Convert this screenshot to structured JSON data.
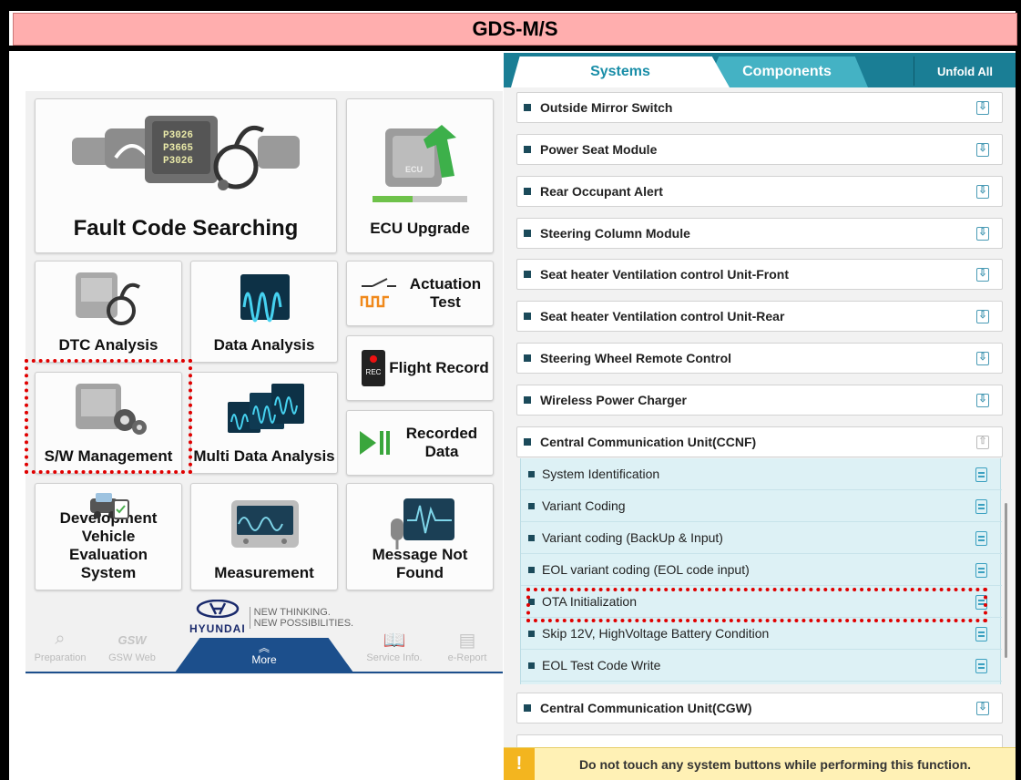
{
  "header": {
    "title": "GDS-M/S"
  },
  "left": {
    "tiles": {
      "fault_code": "Fault Code Searching",
      "ecu_upgrade": "ECU Upgrade",
      "dtc": "DTC Analysis",
      "data_analysis": "Data Analysis",
      "actuation": "Actuation Test",
      "flight_record": "Flight Record",
      "sw_management": "S/W Management",
      "multi_data": "Multi Data Analysis",
      "recorded_data": "Recorded Data",
      "dev_vehicle": "Development Vehicle Evaluation System",
      "measurement": "Measurement",
      "message_nf": "Message Not Found"
    },
    "fault_codes": [
      "P3026",
      "P3665",
      "P3026"
    ],
    "rec_badge": "REC",
    "ecu_badge": "ECU",
    "brand": {
      "name": "HYUNDAI",
      "tag1": "NEW THINKING.",
      "tag2": "NEW POSSIBILITIES."
    },
    "nav": {
      "preparation": "Preparation",
      "gsw_logo": "GSW",
      "gsw_web": "GSW Web",
      "more": "More",
      "service_info": "Service Info.",
      "e_report": "e-Report"
    }
  },
  "right": {
    "tabs": {
      "systems": "Systems",
      "components": "Components",
      "unfold": "Unfold All"
    },
    "systems": [
      "Outside Mirror Switch",
      "Power Seat Module",
      "Rear Occupant Alert",
      "Steering Column Module",
      "Seat heater Ventilation control Unit-Front",
      "Seat heater Ventilation control Unit-Rear",
      "Steering Wheel Remote Control",
      "Wireless Power Charger",
      "Central Communication Unit(CCNF)"
    ],
    "sub_items": [
      "System Identification",
      "Variant Coding",
      "Variant coding (BackUp & Input)",
      "EOL variant coding (EOL code input)",
      "OTA Initialization",
      "Skip 12V, HighVoltage Battery Condition",
      "EOL Test Code Write"
    ],
    "after": "Central Communication Unit(CGW)",
    "warning": "Do not touch any system buttons while performing this function."
  }
}
